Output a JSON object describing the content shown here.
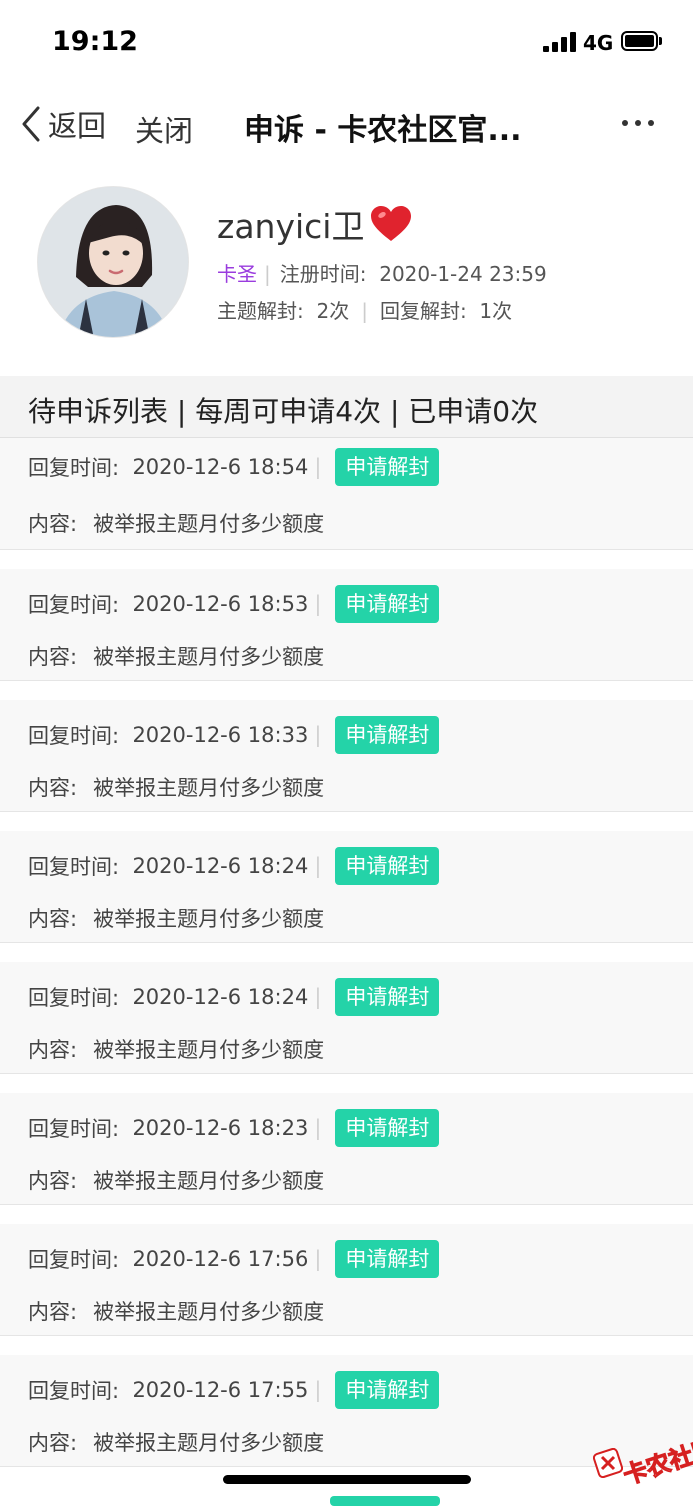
{
  "status_bar": {
    "time": "19:12",
    "network": "4G"
  },
  "nav": {
    "back_label": "返回",
    "close_label": "关闭",
    "title": "申诉 - 卡农社区官..."
  },
  "profile": {
    "username": "zanyici卫",
    "rank": "卡圣",
    "register_label": "注册时间:",
    "register_time": "2020-1-24 23:59",
    "topic_unblock_label": "主题解封:",
    "topic_unblock_count": "2次",
    "reply_unblock_label": "回复解封:",
    "reply_unblock_count": "1次"
  },
  "list_header": "待申诉列表 | 每周可申请4次 | 已申请0次",
  "labels": {
    "reply_time": "回复时间:",
    "content": "内容:",
    "unblock_button": "申请解封"
  },
  "items": [
    {
      "time": "2020-12-6 18:54",
      "content": "被举报主题月付多少额度"
    },
    {
      "time": "2020-12-6 18:53",
      "content": "被举报主题月付多少额度"
    },
    {
      "time": "2020-12-6 18:33",
      "content": "被举报主题月付多少额度"
    },
    {
      "time": "2020-12-6 18:24",
      "content": "被举报主题月付多少额度"
    },
    {
      "time": "2020-12-6 18:24",
      "content": "被举报主题月付多少额度"
    },
    {
      "time": "2020-12-6 18:23",
      "content": "被举报主题月付多少额度"
    },
    {
      "time": "2020-12-6 17:56",
      "content": "被举报主题月付多少额度"
    },
    {
      "time": "2020-12-6 17:55",
      "content": "被举报主题月付多少额度"
    }
  ],
  "watermark": "卡农社区",
  "colors": {
    "accent": "#24d3a8",
    "rank": "#9a3cde",
    "header_bg": "#f3f3f3"
  },
  "icons": {
    "back": "chevron-left-icon",
    "more": "more-dots-icon",
    "heart": "heart-icon"
  }
}
